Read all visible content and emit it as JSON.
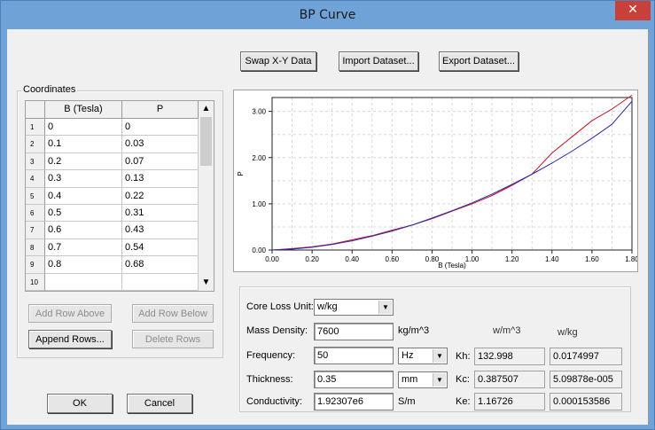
{
  "window": {
    "title": "BP Curve",
    "close_glyph": "✕"
  },
  "toolbar": {
    "swap": "Swap X-Y Data",
    "import": "Import Dataset...",
    "export": "Export Dataset..."
  },
  "coordinates": {
    "group_label": "Coordinates",
    "col_b": "B (Tesla)",
    "col_p": "P",
    "rows": [
      {
        "n": "1",
        "b": "0",
        "p": "0"
      },
      {
        "n": "2",
        "b": "0.1",
        "p": "0.03"
      },
      {
        "n": "3",
        "b": "0.2",
        "p": "0.07"
      },
      {
        "n": "4",
        "b": "0.3",
        "p": "0.13"
      },
      {
        "n": "5",
        "b": "0.4",
        "p": "0.22"
      },
      {
        "n": "6",
        "b": "0.5",
        "p": "0.31"
      },
      {
        "n": "7",
        "b": "0.6",
        "p": "0.43"
      },
      {
        "n": "8",
        "b": "0.7",
        "p": "0.54"
      },
      {
        "n": "9",
        "b": "0.8",
        "p": "0.68"
      },
      {
        "n": "10",
        "b": "",
        "p": ""
      }
    ],
    "add_above": "Add Row Above",
    "add_below": "Add Row Below",
    "append": "Append Rows...",
    "delete": "Delete Rows"
  },
  "dialog": {
    "ok": "OK",
    "cancel": "Cancel"
  },
  "params": {
    "core_loss_unit_label": "Core Loss Unit:",
    "core_loss_unit_value": "w/kg",
    "mass_density_label": "Mass Density:",
    "mass_density_value": "7600",
    "mass_density_unit": "kg/m^3",
    "frequency_label": "Frequency:",
    "frequency_value": "50",
    "frequency_unit": "Hz",
    "thickness_label": "Thickness:",
    "thickness_value": "0.35",
    "thickness_unit": "mm",
    "conductivity_label": "Conductivity:",
    "conductivity_value": "1.92307e6",
    "conductivity_unit": "S/m",
    "col_wm3": "w/m^3",
    "col_wkg": "w/kg",
    "kh_label": "Kh:",
    "kh_wm3": "132.998",
    "kh_wkg": "0.0174997",
    "kc_label": "Kc:",
    "kc_wm3": "0.387507",
    "kc_wkg": "5.09878e-005",
    "ke_label": "Ke:",
    "ke_wm3": "1.16726",
    "ke_wkg": "0.000153586"
  },
  "chart_data": {
    "type": "line",
    "xlabel": "B (Tesla)",
    "ylabel": "P",
    "xlim": [
      0,
      1.8
    ],
    "ylim": [
      0,
      3.3
    ],
    "xticks": [
      "0.00",
      "0.20",
      "0.40",
      "0.60",
      "0.80",
      "1.00",
      "1.20",
      "1.40",
      "1.60",
      "1.80"
    ],
    "yticks": [
      "0.00",
      "1.00",
      "2.00",
      "3.00"
    ],
    "grid": true,
    "series": [
      {
        "color": "#d01020",
        "x": [
          0,
          0.1,
          0.2,
          0.3,
          0.4,
          0.5,
          0.6,
          0.7,
          0.8,
          0.9,
          1.0,
          1.1,
          1.2,
          1.3,
          1.4,
          1.5,
          1.6,
          1.7,
          1.8
        ],
        "y": [
          0,
          0.03,
          0.07,
          0.13,
          0.22,
          0.31,
          0.43,
          0.54,
          0.68,
          0.84,
          1.0,
          1.18,
          1.4,
          1.64,
          2.1,
          2.45,
          2.8,
          3.05,
          3.35
        ]
      },
      {
        "color": "#2a2ab0",
        "x": [
          0,
          0.1,
          0.2,
          0.3,
          0.4,
          0.5,
          0.6,
          0.7,
          0.8,
          0.9,
          1.0,
          1.1,
          1.2,
          1.3,
          1.4,
          1.5,
          1.6,
          1.7,
          1.8
        ],
        "y": [
          0,
          0.02,
          0.06,
          0.12,
          0.2,
          0.3,
          0.41,
          0.54,
          0.69,
          0.85,
          1.02,
          1.21,
          1.42,
          1.64,
          1.88,
          2.14,
          2.42,
          2.72,
          3.22
        ]
      }
    ]
  }
}
